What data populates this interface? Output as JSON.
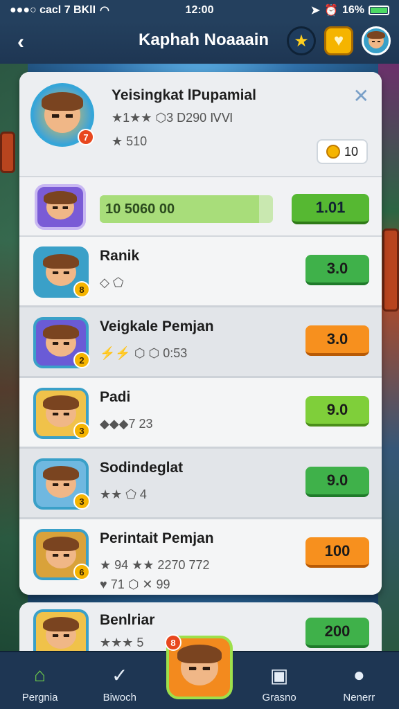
{
  "statusbar": {
    "carrier": "●●●○ cacl 7 BKlI",
    "time": "12:00",
    "battery_pct": "16%"
  },
  "header": {
    "title": "Kaphah Noaaain",
    "icons": [
      "star-icon",
      "heart-badge-icon",
      "profile-avatar-icon"
    ]
  },
  "profile": {
    "name": "Yeisingkat lPupamial",
    "stats_line": "★1★★ ⬡3 D290 ⅣⅥ",
    "sub_line": "★ 510",
    "level_badge": "7",
    "coins": "10"
  },
  "xp": {
    "bar_label": "10 5060 00",
    "progress": 0.92,
    "button": "1.01"
  },
  "rows": [
    {
      "name": "Ranik",
      "stats": "◇ ⬠",
      "stats2": "",
      "badge": "8",
      "button": "3.0",
      "btn_color": "green",
      "avatar_color": "#3aa0c8"
    },
    {
      "name": "Veigkale Pemjan",
      "stats": "⚡⚡ ⬡ ⬡ 0:53",
      "stats2": "",
      "badge": "2",
      "button": "3.0",
      "btn_color": "orange",
      "avatar_color": "#6a5bd6"
    },
    {
      "name": "Padi",
      "stats": "◆◆◆7 23",
      "stats2": "",
      "badge": "3",
      "button": "9.0",
      "btn_color": "lime",
      "avatar_color": "#f0c24a"
    },
    {
      "name": "Sodindeglat",
      "stats": "★★ ⬠ 4",
      "stats2": "",
      "badge": "3",
      "button": "9.0",
      "btn_color": "green",
      "avatar_color": "#6fb8e0"
    },
    {
      "name": "Perintait Pemjan",
      "stats": "★ 94 ★★ 2270 772",
      "stats2": "♥ 71 ⬡ ✕ 99",
      "badge": "6",
      "button": "100",
      "btn_color": "orange",
      "avatar_color": "#d9a23a"
    }
  ],
  "peek": {
    "name": "Benlriar",
    "stats": "★★★ 5",
    "button": "200"
  },
  "nav": [
    {
      "label": "Pergnia",
      "icon": "home-icon"
    },
    {
      "label": "Biwoch",
      "icon": "check-circle-icon"
    },
    {
      "label": "",
      "icon": "center-hero-icon",
      "badge": "8"
    },
    {
      "label": "Grasno",
      "icon": "card-icon"
    },
    {
      "label": "Nenerr",
      "icon": "user-icon"
    }
  ]
}
